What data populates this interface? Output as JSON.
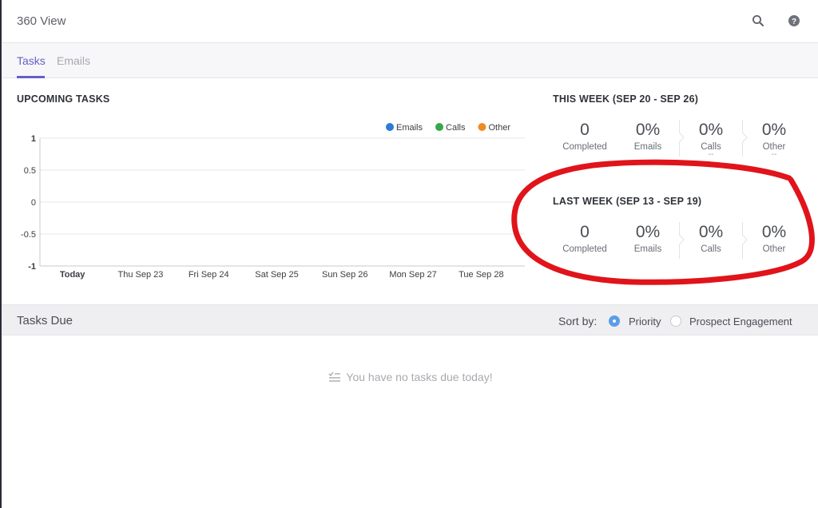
{
  "header": {
    "title": "360 View"
  },
  "tabs": [
    {
      "label": "Tasks"
    },
    {
      "label": "Emails"
    }
  ],
  "upcoming": {
    "title": "UPCOMING TASKS",
    "chart_data": {
      "type": "bar",
      "categories": [
        "Today",
        "Thu Sep 23",
        "Fri Sep 24",
        "Sat Sep 25",
        "Sun Sep 26",
        "Mon Sep 27",
        "Tue Sep 28"
      ],
      "series": [
        {
          "name": "Emails",
          "color": "#2b7bd6",
          "values": [
            0,
            0,
            0,
            0,
            0,
            0,
            0
          ]
        },
        {
          "name": "Calls",
          "color": "#36a84a",
          "values": [
            0,
            0,
            0,
            0,
            0,
            0,
            0
          ]
        },
        {
          "name": "Other",
          "color": "#f08a24",
          "values": [
            0,
            0,
            0,
            0,
            0,
            0,
            0
          ]
        }
      ],
      "yticks": [
        "1",
        "0.5",
        "0",
        "-0.5",
        "-1"
      ],
      "ylim": [
        -1,
        1
      ],
      "grid": true,
      "legend": "top-right"
    }
  },
  "this_week": {
    "title": "THIS WEEK (SEP 20 - SEP 26)",
    "stats": [
      {
        "value": "0",
        "label": "Completed",
        "sub": ""
      },
      {
        "value": "0%",
        "label": "Emails",
        "sub": ""
      },
      {
        "value": "0%",
        "label": "Calls",
        "sub": "--"
      },
      {
        "value": "0%",
        "label": "Other",
        "sub": "--"
      }
    ]
  },
  "last_week": {
    "title": "LAST WEEK (SEP 13 - SEP 19)",
    "stats": [
      {
        "value": "0",
        "label": "Completed",
        "sub": ""
      },
      {
        "value": "0%",
        "label": "Emails",
        "sub": ""
      },
      {
        "value": "0%",
        "label": "Calls",
        "sub": ""
      },
      {
        "value": "0%",
        "label": "Other",
        "sub": ""
      }
    ]
  },
  "tasks_due": {
    "title": "Tasks Due",
    "sort_label": "Sort by:",
    "options": [
      {
        "label": "Priority",
        "selected": true
      },
      {
        "label": "Prospect Engagement",
        "selected": false
      }
    ],
    "empty_message": "You have no tasks due today!"
  },
  "colors": {
    "accent": "#6560c7",
    "radio_selected": "#5b9de8",
    "annotation": "#e0141a"
  }
}
